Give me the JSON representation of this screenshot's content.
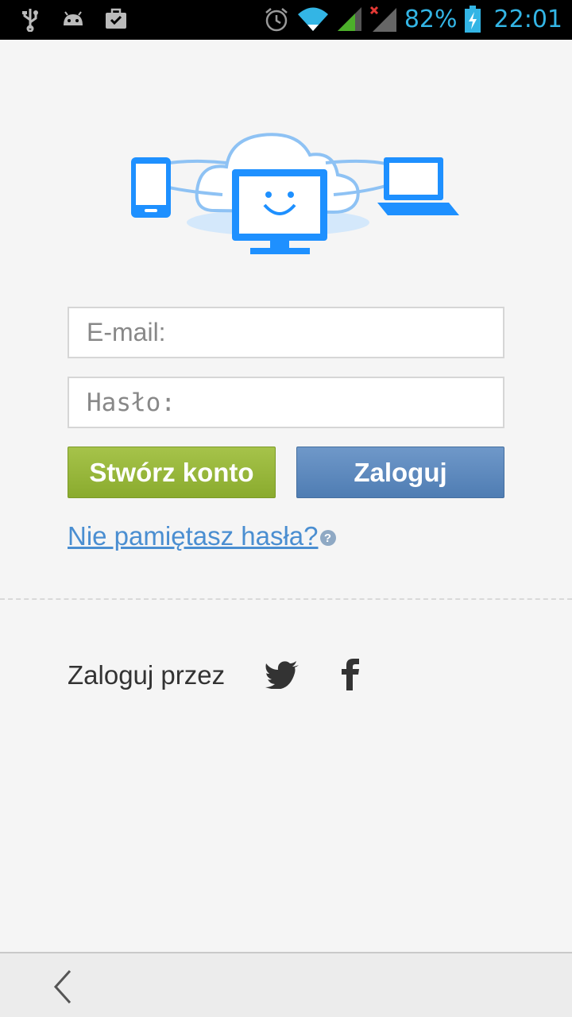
{
  "status_bar": {
    "left_icons": [
      "usb-icon",
      "android-debug-icon",
      "briefcase-check-icon"
    ],
    "right_icons": [
      "alarm-icon",
      "wifi-icon",
      "signal-icon",
      "signal-no-service-icon",
      "battery-charging-icon"
    ],
    "battery_percent": "82%",
    "time": "22:01",
    "accent_color": "#33b5e5"
  },
  "illustration": {
    "icon": "cloud-devices-sync-icon",
    "color": "#1e90ff"
  },
  "form": {
    "email_placeholder": "E-mail:",
    "password_placeholder": "Hasło:",
    "create_account_label": "Stwórz konto",
    "login_label": "Zaloguj",
    "forgot_password_label": "Nie pamiętasz hasła?",
    "help_glyph": "?"
  },
  "social_login": {
    "label": "Zaloguj przez",
    "providers": [
      "twitter-icon",
      "facebook-icon"
    ]
  },
  "navigation": {
    "back_icon": "back-chevron-icon"
  },
  "colors": {
    "create_button": "#97b73a",
    "login_button": "#5f8bc0",
    "link": "#4a8ed1"
  }
}
